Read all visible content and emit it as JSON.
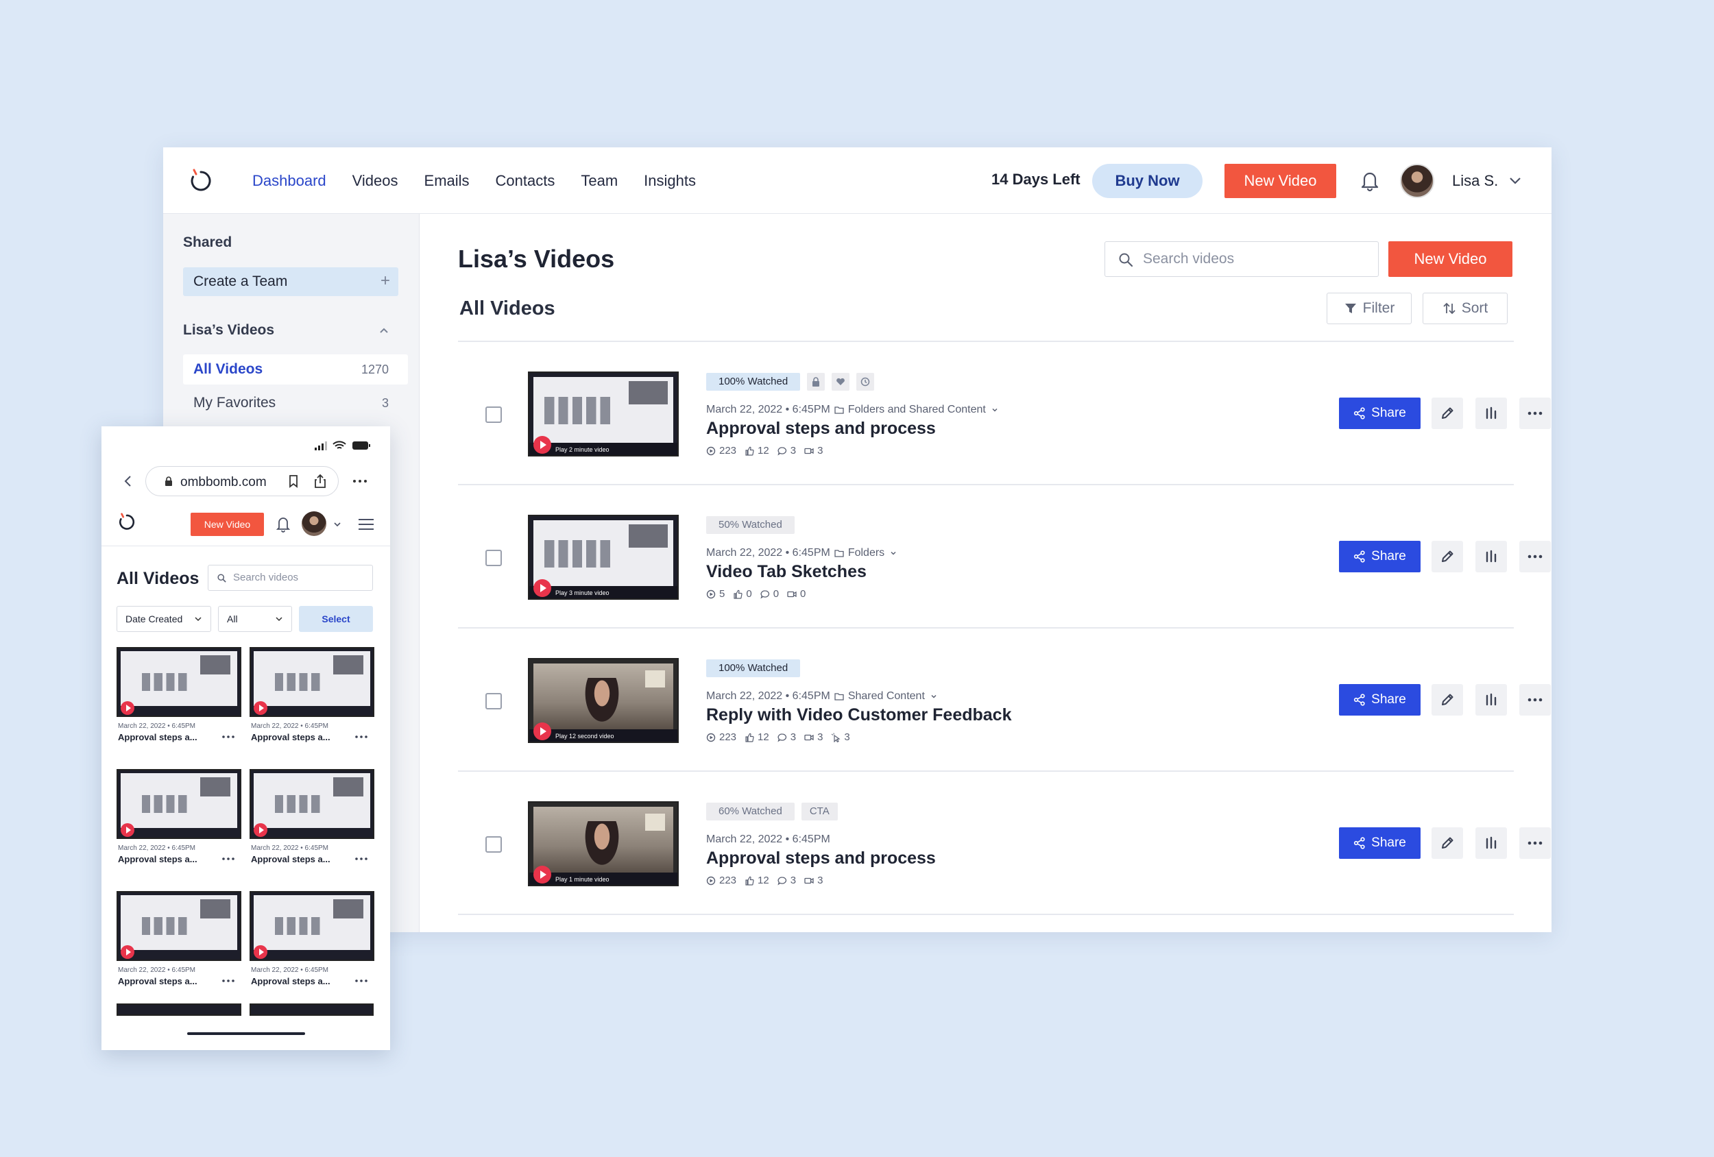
{
  "nav": {
    "items": [
      {
        "label": "Dashboard",
        "active": true
      },
      {
        "label": "Videos",
        "active": false
      },
      {
        "label": "Emails",
        "active": false
      },
      {
        "label": "Contacts",
        "active": false
      },
      {
        "label": "Team",
        "active": false
      },
      {
        "label": "Insights",
        "active": false
      }
    ],
    "days_left": "14 Days Left",
    "buy_now": "Buy Now",
    "new_video": "New Video",
    "user_name": "Lisa S."
  },
  "sidebar": {
    "shared_heading": "Shared",
    "create_team": "Create a Team",
    "section_heading": "Lisa’s Videos",
    "items": [
      {
        "label": "All Videos",
        "count": "1270",
        "active": true
      },
      {
        "label": "My Favorites",
        "count": "3",
        "active": false
      }
    ]
  },
  "main": {
    "title": "Lisa’s Videos",
    "search_placeholder": "Search videos",
    "new_video": "New Video",
    "subtitle": "All Videos",
    "filter_label": "Filter",
    "sort_label": "Sort",
    "share_label": "Share",
    "videos": [
      {
        "tags": [
          "100% Watched"
        ],
        "tag_style": "blue",
        "tag_icons": [
          "lock-icon",
          "heart-icon",
          "clock-icon"
        ],
        "date": "March 22, 2022 • 6:45PM",
        "folder": "Folders and Shared Content",
        "title": "Approval steps and process",
        "thumb": "screen",
        "thumb_caption": "Play 2 minute video",
        "stats": {
          "views": "223",
          "likes": "12",
          "comments": "3",
          "replies": "3",
          "clicks": ""
        }
      },
      {
        "tags": [
          "50% Watched"
        ],
        "tag_style": "grey",
        "tag_icons": [],
        "date": "March 22, 2022 • 6:45PM",
        "folder": "Folders",
        "title": "Video Tab Sketches",
        "thumb": "screen",
        "thumb_caption": "Play 3 minute video",
        "stats": {
          "views": "5",
          "likes": "0",
          "comments": "0",
          "replies": "0",
          "clicks": ""
        }
      },
      {
        "tags": [
          "100% Watched"
        ],
        "tag_style": "blue",
        "tag_icons": [],
        "date": "March 22, 2022 • 6:45PM",
        "folder": "Shared Content",
        "title": "Reply with Video Customer Feedback",
        "thumb": "cam",
        "thumb_caption": "Play 12 second video",
        "stats": {
          "views": "223",
          "likes": "12",
          "comments": "3",
          "replies": "3",
          "clicks": "3"
        }
      },
      {
        "tags": [
          "60% Watched",
          "CTA"
        ],
        "tag_style": "grey",
        "tag_icons": [],
        "date": "March 22, 2022 • 6:45PM",
        "folder": "",
        "title": "Approval steps and process",
        "thumb": "cam",
        "thumb_caption": "Play 1 minute video",
        "stats": {
          "views": "223",
          "likes": "12",
          "comments": "3",
          "replies": "3",
          "clicks": ""
        }
      }
    ]
  },
  "mobile": {
    "url": "ombbomb.com",
    "new_video": "New Video",
    "title": "All Videos",
    "search_placeholder": "Search videos",
    "sort_select": "Date Created",
    "filter_select": "All",
    "select_label": "Select",
    "cards": [
      {
        "date": "March 22, 2022 • 6:45PM",
        "title": "Approval steps a..."
      },
      {
        "date": "March 22, 2022 • 6:45PM",
        "title": "Approval steps a..."
      },
      {
        "date": "March 22, 2022 • 6:45PM",
        "title": "Approval steps a..."
      },
      {
        "date": "March 22, 2022 • 6:45PM",
        "title": "Approval steps a..."
      },
      {
        "date": "March 22, 2022 • 6:45PM",
        "title": "Approval steps a..."
      },
      {
        "date": "March 22, 2022 • 6:45PM",
        "title": "Approval steps a..."
      }
    ]
  },
  "colors": {
    "accent_orange": "#f2563f",
    "share_blue": "#2b4be0",
    "nav_active": "#2a46c9",
    "background": "#dce8f7"
  }
}
